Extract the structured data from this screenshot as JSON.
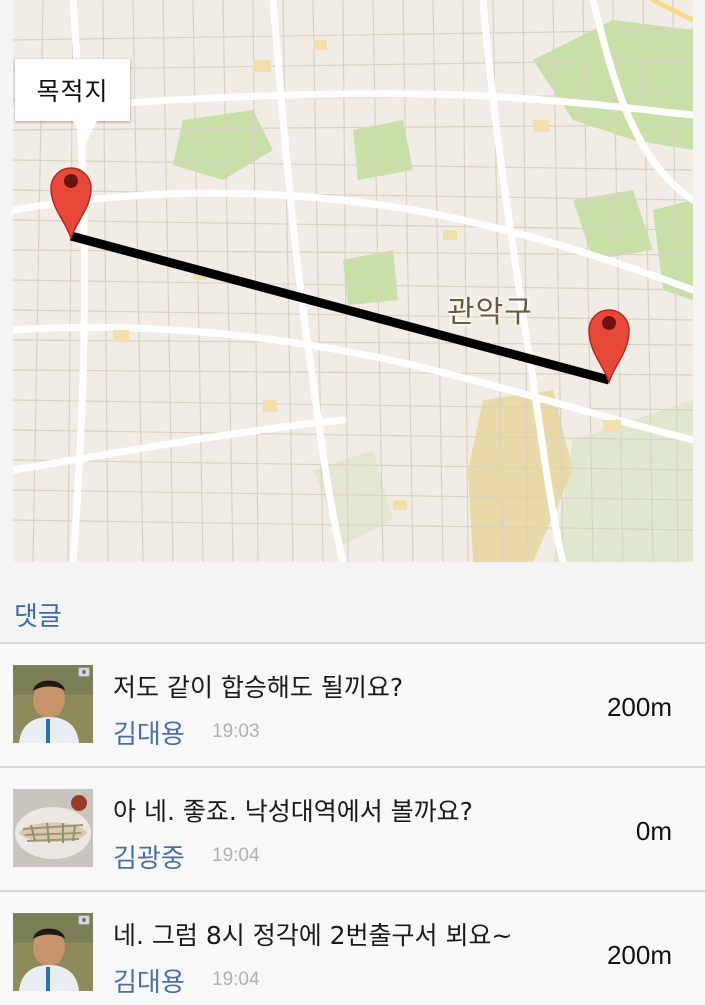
{
  "map": {
    "destination_label": "목적지",
    "district_label": "관악구"
  },
  "comments_section": {
    "title": "댓글",
    "items": [
      {
        "message": "저도 같이 합승해도 될끼요?",
        "author": "김대용",
        "time": "19:03",
        "distance": "200m",
        "avatar": "man-photo",
        "has_camera_badge": true
      },
      {
        "message": "아 네. 좋죠. 낙성대역에서 볼까요?",
        "author": "김광중",
        "time": "19:04",
        "distance": "0m",
        "avatar": "food-photo",
        "has_camera_badge": false
      },
      {
        "message": "네. 그럼 8시 정각에 2번출구서 뵈요~",
        "author": "김대용",
        "time": "19:04",
        "distance": "200m",
        "avatar": "man-photo",
        "has_camera_badge": true
      }
    ]
  },
  "colors": {
    "accent_text": "#3a6aa8",
    "pin": "#e8483a",
    "route": "#000000",
    "map_background": "#f1ede6",
    "park": "#c8dfa8"
  }
}
